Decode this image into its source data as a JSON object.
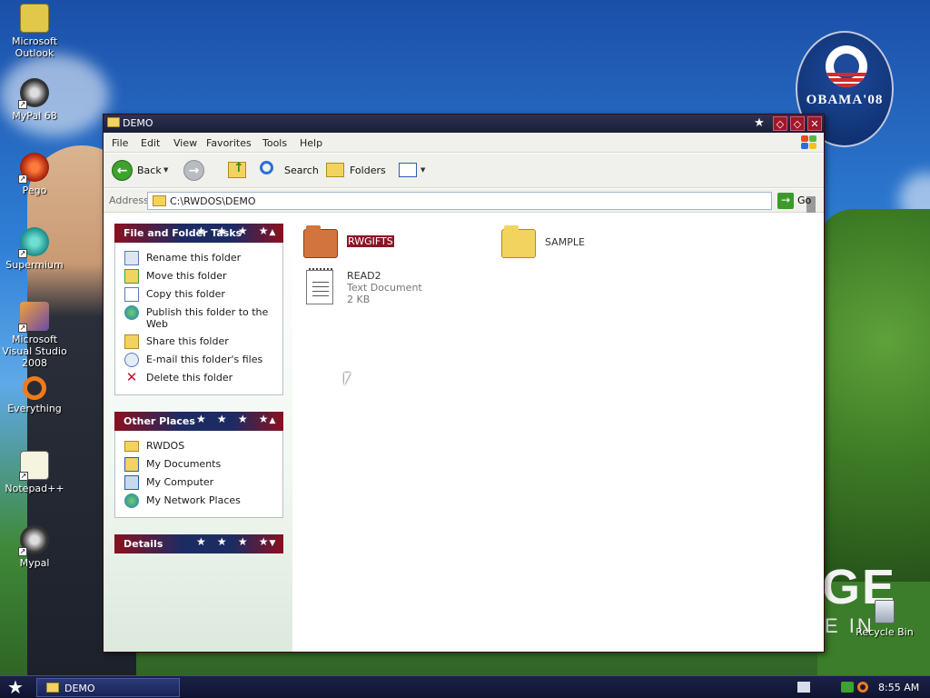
{
  "desktop": {
    "icons": [
      {
        "label": "Microsoft Outlook"
      },
      {
        "label": "MyPal 68"
      },
      {
        "label": "Pego"
      },
      {
        "label": "Supermium"
      },
      {
        "label": "Microsoft Visual Studio 2008"
      },
      {
        "label": "Everything"
      },
      {
        "label": "Notepad++"
      },
      {
        "label": "Mypal"
      },
      {
        "label": "Recycle Bin"
      }
    ],
    "badge_text": "OBAMA'08",
    "slogan": "GE",
    "slogan2": "E IN"
  },
  "window": {
    "title": "DEMO",
    "menu": [
      "File",
      "Edit",
      "View",
      "Favorites",
      "Tools",
      "Help"
    ],
    "toolbar": {
      "back": "Back",
      "search": "Search",
      "folders": "Folders"
    },
    "address": {
      "label": "Address",
      "value": "C:\\RWDOS\\DEMO",
      "go": "Go"
    },
    "file_tasks": {
      "title": "File and Folder Tasks",
      "items": [
        "Rename this folder",
        "Move this folder",
        "Copy this folder",
        "Publish this folder to the Web",
        "Share this folder",
        "E-mail this folder's files",
        "Delete this folder"
      ]
    },
    "other_places": {
      "title": "Other Places",
      "items": [
        "RWDOS",
        "My Documents",
        "My Computer",
        "My Network Places"
      ]
    },
    "details": {
      "title": "Details"
    },
    "files": [
      {
        "name": "RWGIFTS",
        "selected": true
      },
      {
        "name": "SAMPLE",
        "selected": false
      },
      {
        "name": "READ2",
        "type": "Text Document",
        "size": "2 KB"
      }
    ]
  },
  "taskbar": {
    "task": "DEMO",
    "clock": "8:55 AM"
  },
  "colors": {
    "accent_red": "#8c1426",
    "accent_navy": "#1d2b63",
    "folder_yellow": "#f3d35f"
  }
}
